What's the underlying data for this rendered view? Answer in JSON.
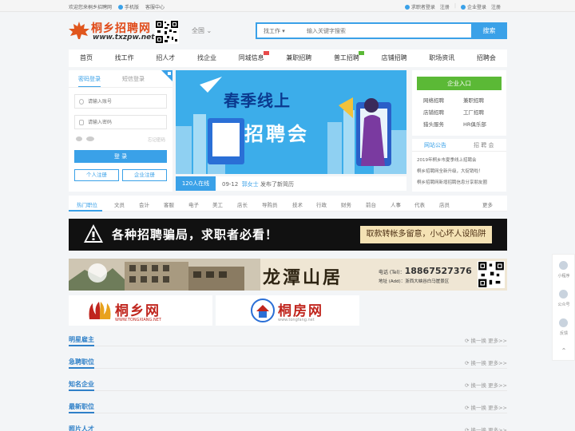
{
  "topbar": {
    "welcome": "欢迎您来桐乡招聘网",
    "mobile": "手机版",
    "service": "客服中心",
    "seeker_login": "求职者登录",
    "seeker_register": "注册",
    "company_login": "企业登录",
    "company_register": "注册"
  },
  "logo": {
    "brand": "桐乡招聘网",
    "url": "www.txzpw.net"
  },
  "city": "全国",
  "search": {
    "type": "找工作",
    "placeholder": "输入关键字搜索",
    "button": "搜索"
  },
  "nav": [
    "首页",
    "找工作",
    "招人才",
    "找企业",
    "同城信息",
    "兼职招聘",
    "普工招聘",
    "店铺招聘",
    "职场资讯",
    "招聘会"
  ],
  "login": {
    "tab_password": "密码登录",
    "tab_sms": "短信登录",
    "account_placeholder": "请输入账号",
    "password_placeholder": "请输入密码",
    "forgot": "忘记密码",
    "login_button": "登 录",
    "personal_register": "个人注册",
    "company_register": "企业注册"
  },
  "banner": {
    "line1": "春季线上",
    "line2": "招聘会"
  },
  "online": {
    "count": "120人在线",
    "date": "09-12",
    "user": "郭女士",
    "action": "发布了新简历"
  },
  "entry": {
    "button": "企业入口",
    "links": [
      "网络招聘",
      "兼职招聘",
      "店铺招聘",
      "工厂招聘",
      "猎头服务",
      "HR俱乐部"
    ]
  },
  "notice": {
    "tab_announce": "网站公告",
    "tab_fair": "招 聘 会",
    "items": [
      "2019年桐乡市夏季线上招聘会",
      "桐乡招聘网全新升级，大促销啦！",
      "桐乡招聘网新增招聘信息分享朋友圈"
    ]
  },
  "categories": [
    "热门职位",
    "文员",
    "会计",
    "客服",
    "电子",
    "美工",
    "店长",
    "导购员",
    "技术",
    "行政",
    "财务",
    "前台",
    "人事",
    "代表",
    "店员",
    "更多"
  ],
  "ad_fraud": {
    "title": "各种招聘骗局，求职者必看！",
    "note": "取款转帐多留意，小心坏人设陷阱"
  },
  "ad_estate": {
    "title": "龙潭山居",
    "tel_label": "电话 (Tel)：",
    "tel": "18867527376",
    "addr": "地址 (Add)：浙西大峡谷白马崖景区"
  },
  "partners": [
    {
      "name": "桐乡网",
      "url": "WWW.TONGXIANG.NET"
    },
    {
      "name": "桐房网",
      "url": "www.tongfang.net"
    }
  ],
  "sections": {
    "more_label": "换一换  更多>>",
    "titles": [
      "明星雇主",
      "急聘职位",
      "知名企业",
      "最新职位",
      "照片人才"
    ]
  },
  "float": [
    "小程序",
    "公众号",
    "反馈"
  ]
}
